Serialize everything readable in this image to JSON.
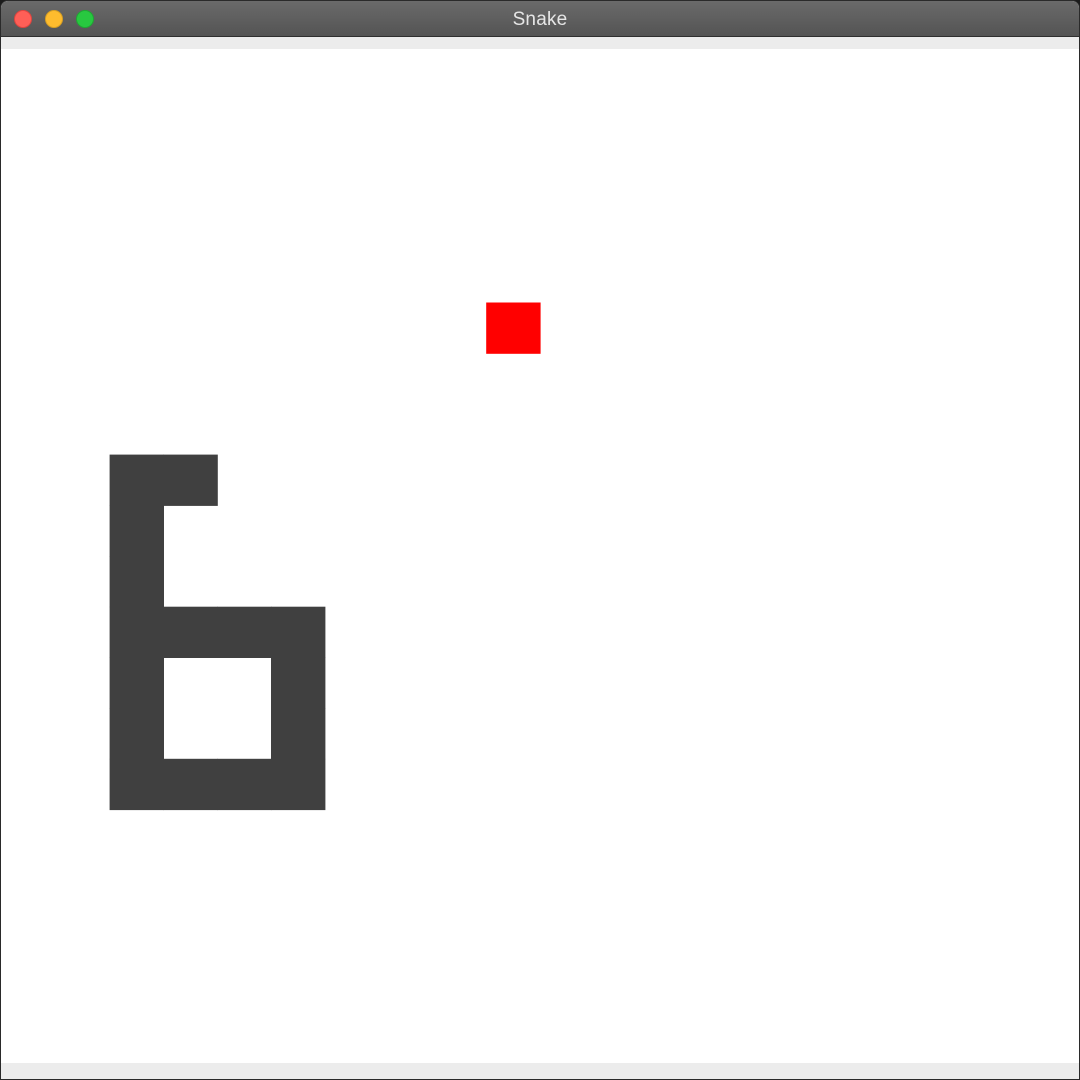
{
  "window": {
    "title": "Snake",
    "controls": [
      "close",
      "minimize",
      "zoom"
    ]
  },
  "game": {
    "grid_columns": 20,
    "grid_rows": 20,
    "snake_color": "#404040",
    "food_color": "#ff0000",
    "background_color": "#ffffff",
    "food": {
      "col": 9,
      "row": 5
    },
    "snake": [
      {
        "col": 3,
        "row": 8
      },
      {
        "col": 2,
        "row": 8
      },
      {
        "col": 2,
        "row": 9
      },
      {
        "col": 2,
        "row": 10
      },
      {
        "col": 2,
        "row": 11
      },
      {
        "col": 3,
        "row": 11
      },
      {
        "col": 4,
        "row": 11
      },
      {
        "col": 5,
        "row": 11
      },
      {
        "col": 5,
        "row": 12
      },
      {
        "col": 5,
        "row": 13
      },
      {
        "col": 5,
        "row": 14
      },
      {
        "col": 4,
        "row": 14
      },
      {
        "col": 3,
        "row": 14
      },
      {
        "col": 2,
        "row": 14
      },
      {
        "col": 2,
        "row": 13
      },
      {
        "col": 2,
        "row": 12
      }
    ]
  }
}
